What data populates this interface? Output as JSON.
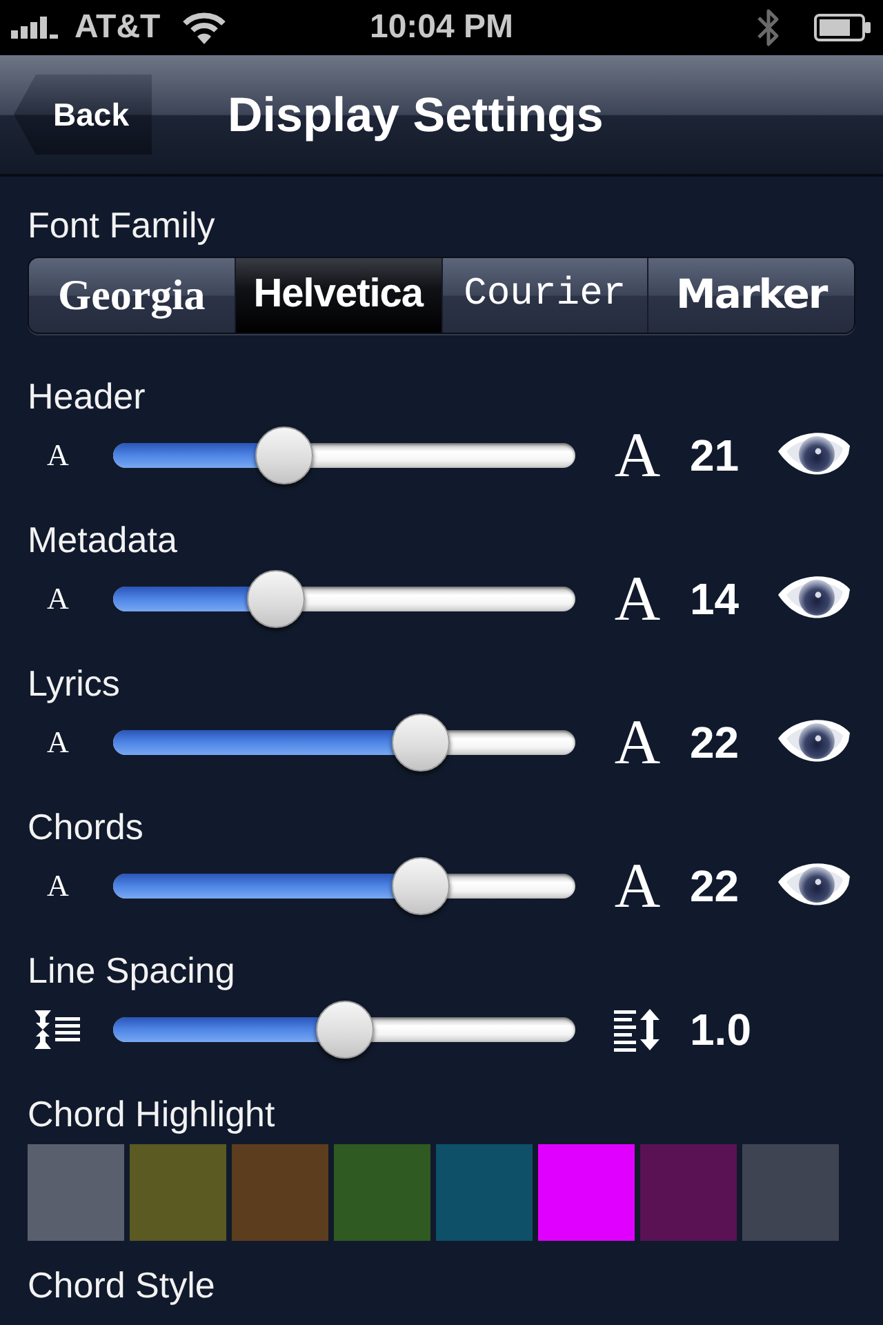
{
  "status_bar": {
    "carrier": "AT&T",
    "time": "10:04 PM"
  },
  "nav_bar": {
    "back_button": "Back",
    "title": "Display Settings"
  },
  "font_family": {
    "label": "Font Family",
    "options": [
      {
        "label": "Georgia",
        "kind": "serif",
        "selected": false
      },
      {
        "label": "Helvetica",
        "kind": "sans",
        "selected": true
      },
      {
        "label": "Courier",
        "kind": "mono",
        "selected": false
      },
      {
        "label": "Marker",
        "kind": "marker",
        "selected": false
      }
    ]
  },
  "sliders": [
    {
      "label": "Header",
      "kind": "font-size",
      "min_label": "A",
      "max_label": "A",
      "level": 0.35,
      "value": "21"
    },
    {
      "label": "Metadata",
      "kind": "font-size",
      "min_label": "A",
      "max_label": "A",
      "level": 0.33,
      "value": "14"
    },
    {
      "label": "Lyrics",
      "kind": "font-size",
      "min_label": "A",
      "max_label": "A",
      "level": 0.69,
      "value": "22"
    },
    {
      "label": "Chords",
      "kind": "font-size",
      "min_label": "A",
      "max_label": "A",
      "level": 0.69,
      "value": "22"
    },
    {
      "label": "Line Spacing",
      "kind": "line-spacing",
      "level": 0.5,
      "value": "1.0"
    }
  ],
  "chord_highlight": {
    "label": "Chord Highlight",
    "swatches": [
      {
        "color": "#5a5f6e"
      },
      {
        "color": "#5a5a22"
      },
      {
        "color": "#5c3d1e"
      },
      {
        "color": "#2f5a22"
      },
      {
        "color": "#0d5068"
      },
      {
        "color": "#e000ff"
      },
      {
        "color": "#5a1255"
      },
      {
        "color": "#3f4453"
      }
    ]
  },
  "chord_style": {
    "label": "Chord Style"
  }
}
